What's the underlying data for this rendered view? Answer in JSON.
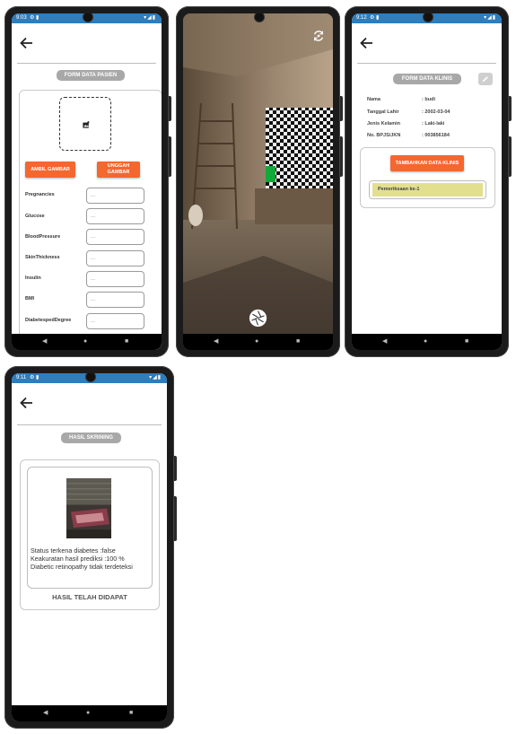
{
  "colors": {
    "accent": "#f4672f",
    "status_bar": "#2e7dbd",
    "pill": "#a8a8a8",
    "exam_item": "#e2e08f"
  },
  "screen1": {
    "status_time": "9:03",
    "title": "FORM DATA PASIEN",
    "photo_placeholder_icon": "add-photo-icon",
    "btn_ambil": "AMBIL GAMBAR",
    "btn_unggah": "UNGGAH GAMBAR",
    "input_placeholder": "...",
    "fields": [
      "Pregnancies",
      "Glucose",
      "BloodPressure",
      "SkinThickness",
      "Insulin",
      "BMI",
      "DiabetespedDegree"
    ]
  },
  "screen2": {
    "switch_camera_icon": "camera-switch-icon",
    "shutter_icon": "shutter-icon"
  },
  "screen3": {
    "status_time": "9:12",
    "title": "FORM DATA KLINIS",
    "edit_icon": "pencil-icon",
    "patient": [
      {
        "label": "Nama",
        "value": ": budi"
      },
      {
        "label": "Tanggal Lahir",
        "value": ": 2002-03-04"
      },
      {
        "label": "Jenis Kelamin",
        "value": ": Laki-laki"
      },
      {
        "label": "No. BPJS/JKN",
        "value": ": 003856184"
      }
    ],
    "btn_tambah": "TAMBAHKAN DATA KLINIS",
    "exam_item": "Pemeriksaan ke-1"
  },
  "screen4": {
    "status_time": "9:11",
    "title": "HASIL SKRINING",
    "result_line1": "Status terkena diabetes :false",
    "result_line2": "Keakuratan hasil prediksi :100 %",
    "result_line3": "Diabetic retinopathy tidak terdeteksi",
    "footer": "HASIL TELAH DIDAPAT"
  },
  "nav": {
    "back": "◀",
    "home": "●",
    "recents": "■"
  }
}
